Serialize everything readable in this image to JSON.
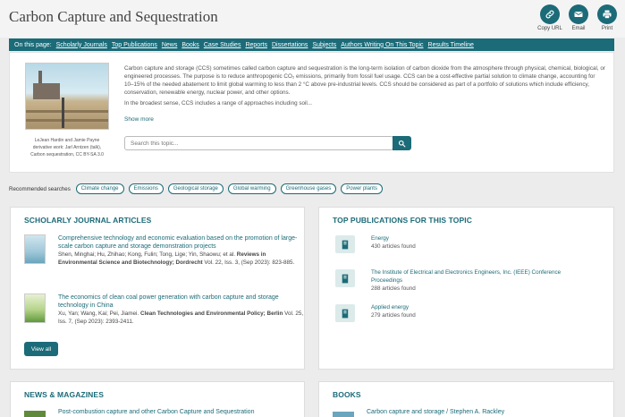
{
  "header": {
    "title": "Carbon Capture and Sequestration",
    "actions": [
      {
        "label": "Copy URL",
        "icon": "link-icon"
      },
      {
        "label": "Email",
        "icon": "email-icon"
      },
      {
        "label": "Print",
        "icon": "print-icon"
      }
    ]
  },
  "nav": {
    "label": "On this page:",
    "links": [
      "Scholarly Journals",
      "Top Publications",
      "News",
      "Books",
      "Case Studies",
      "Reports",
      "Dissertations",
      "Subjects",
      "Authors Writing On This Topic",
      "Results Timeline"
    ]
  },
  "overview": {
    "image_caption": "LeJean Hardin and Jamie Payne derivative work: Jarl Arntzen (talk), Carbon sequestration, CC BY-SA 3.0",
    "paragraph1": "Carbon capture and storage (CCS) sometimes called carbon capture and sequestration is the long-term isolation of carbon dioxide from the atmosphere through physical, chemical, biological, or engineered processes. The purpose is to reduce anthropogenic CO₂ emissions, primarily from fossil fuel usage. CCS can be a cost-effective partial solution to climate change, accounting for 10–15% of the needed abatement to limit global warming to less than 2 °C above pre-industrial levels. CCS should be considered as part of a portfolio of solutions which include efficiency, conservation, renewable energy, nuclear power, and other options.",
    "paragraph2": "In the broadest sense, CCS includes a range of approaches including soil...",
    "show_more": "Show more",
    "search_placeholder": "Search this topic..."
  },
  "recommended": {
    "label": "Recommended searches",
    "chips": [
      "Climate change",
      "Emissions",
      "Geological storage",
      "Global warming",
      "Greenhouse gases",
      "Power plants"
    ]
  },
  "journals": {
    "title": "SCHOLARLY JOURNAL ARTICLES",
    "articles": [
      {
        "title": "Comprehensive technology and economic evaluation based on the promotion of large-scale carbon capture and storage demonstration projects",
        "authors": "Shen, Minghai; Hu, Zhihao; Kong, Fulin; Tong, Lige; Yin, Shaowu; et al.",
        "journal": "Reviews in Environmental Science and Biotechnology; Dordrecht",
        "details": "Vol. 22, Iss. 3,  (Sep 2023): 823-885."
      },
      {
        "title": "The economics of clean coal power generation with carbon capture and storage technology in China",
        "authors": "Xu, Yan; Wang, Kai; Pei, Jiamei.",
        "journal": "Clean Technologies and Environmental Policy; Berlin",
        "details": "Vol. 25, Iss. 7,  (Sep 2023): 2393-2411."
      }
    ],
    "view_all": "View all"
  },
  "publications": {
    "title": "TOP PUBLICATIONS FOR THIS TOPIC",
    "items": [
      {
        "name": "Energy",
        "count": "430 articles found"
      },
      {
        "name": "The Institute of Electrical and Electronics Engineers, Inc. (IEEE) Conference Proceedings",
        "count": "288 articles found"
      },
      {
        "name": "Applied energy",
        "count": "279 articles found"
      }
    ]
  },
  "news": {
    "title": "NEWS & MAGAZINES",
    "first_item": "Post-combustion capture and other Carbon Capture and Sequestration"
  },
  "books": {
    "title": "BOOKS",
    "first_item": "Carbon capture and storage / Stephen A. Rackley"
  },
  "colors": {
    "accent": "#1b6b78",
    "background": "#ececec",
    "card": "#ffffff"
  }
}
